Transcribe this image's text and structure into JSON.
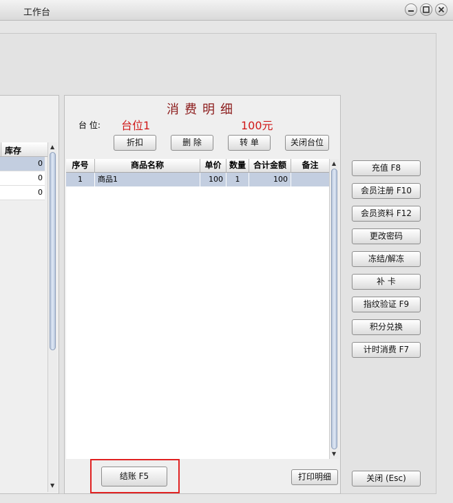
{
  "window": {
    "title": "工作台"
  },
  "left_table": {
    "header": "库存",
    "rows": [
      "0",
      "0",
      "0"
    ]
  },
  "detail": {
    "title": "消费明细",
    "table_label": "台 位:",
    "table_value": "台位1",
    "amount": "100元",
    "buttons": {
      "discount": "折扣",
      "delete": "删 除",
      "transfer": "转 单",
      "close_table": "关闭台位"
    },
    "columns": [
      "序号",
      "商品名称",
      "单价",
      "数量",
      "合计金额",
      "备注"
    ],
    "rows": [
      {
        "no": "1",
        "name": "商品1",
        "price": "100",
        "qty": "1",
        "total": "100",
        "note": ""
      }
    ],
    "checkout": "结账  F5",
    "print": "打印明细"
  },
  "right_buttons": [
    "充值 F8",
    "会员注册 F10",
    "会员资料 F12",
    "更改密码",
    "冻结/解冻",
    "补 卡",
    "指纹验证 F9",
    "积分兑换",
    "计时消费  F7"
  ],
  "close_button": "关闭 (Esc)"
}
